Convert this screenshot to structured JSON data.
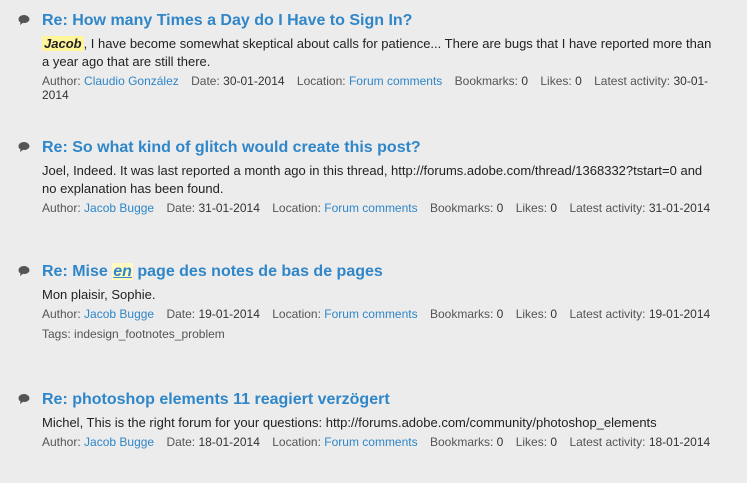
{
  "colors": {
    "background": "#ececec",
    "title_link": "#2f86c8",
    "highlight": "#fff59a",
    "text": "#222222",
    "meta_text": "#555555"
  },
  "labels": {
    "author": "Author:",
    "date": "Date:",
    "location": "Location:",
    "bookmarks": "Bookmarks:",
    "likes": "Likes:",
    "latest_activity": "Latest activity:",
    "tags": "Tags:"
  },
  "results": [
    {
      "icon": "speech-bubble-icon",
      "title_prefix": "Re: How many Times a Day do I Have to Sign In?",
      "title_highlight": "",
      "title_suffix": "",
      "snippet_highlight": "Jacob",
      "snippet_rest": ", I have become somewhat skeptical about calls for patience... There are bugs that I have reported more than a year ago that are still there.",
      "author": "Claudio González",
      "date": "30-01-2014",
      "location": "Forum comments",
      "bookmarks": "0",
      "likes": "0",
      "latest_activity": "30-01-2014",
      "tags": ""
    },
    {
      "icon": "speech-bubble-icon",
      "title_prefix": "Re: So what kind of glitch would create this post?",
      "title_highlight": "",
      "title_suffix": "",
      "snippet_highlight": "",
      "snippet_rest": "Joel, Indeed. It was last reported a month ago in this thread, http://forums.adobe.com/thread/1368332?tstart=0 and no explanation has been found.",
      "author": "Jacob Bugge",
      "date": "31-01-2014",
      "location": "Forum comments",
      "bookmarks": "0",
      "likes": "0",
      "latest_activity": "31-01-2014",
      "tags": ""
    },
    {
      "icon": "speech-bubble-icon",
      "title_prefix": "Re: Mise ",
      "title_highlight": "en",
      "title_suffix": " page des notes de bas de pages",
      "snippet_highlight": "",
      "snippet_rest": "Mon plaisir, Sophie.",
      "author": "Jacob Bugge",
      "date": "19-01-2014",
      "location": "Forum comments",
      "bookmarks": "0",
      "likes": "0",
      "latest_activity": "19-01-2014",
      "tags": "indesign_footnotes_problem"
    },
    {
      "icon": "speech-bubble-icon",
      "title_prefix": "Re: photoshop elements 11 reagiert verzögert",
      "title_highlight": "",
      "title_suffix": "",
      "snippet_highlight": "",
      "snippet_rest": "Michel, This is the right forum for your questions: http://forums.adobe.com/community/photoshop_elements",
      "author": "Jacob Bugge",
      "date": "18-01-2014",
      "location": "Forum comments",
      "bookmarks": "0",
      "likes": "0",
      "latest_activity": "18-01-2014",
      "tags": ""
    }
  ]
}
